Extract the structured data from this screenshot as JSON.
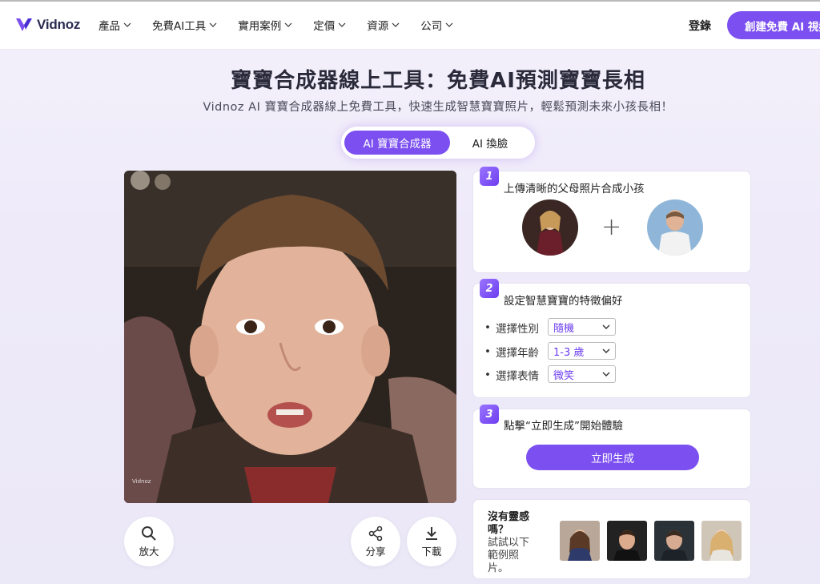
{
  "nav": {
    "logo_text": "Vidnoz",
    "menu": [
      {
        "label": "產品"
      },
      {
        "label": "免費AI工具"
      },
      {
        "label": "實用案例"
      },
      {
        "label": "定價"
      },
      {
        "label": "資源"
      },
      {
        "label": "公司"
      }
    ],
    "login_label": "登錄",
    "cta_label": "創建免費 AI 視頻"
  },
  "header": {
    "title": "寶寶合成器線上工具：免費AI預測寶寶長相",
    "subtitle": "Vidnoz AI 寶寶合成器線上免費工具，快速生成智慧寶寶照片，輕鬆預測未來小孩長相！"
  },
  "tabs": [
    {
      "label": "AI 寶寶合成器",
      "active": true
    },
    {
      "label": "AI 換臉",
      "active": false
    }
  ],
  "result": {
    "watermark": "Vidnoz",
    "zoom_label": "放大",
    "share_label": "分享",
    "download_label": "下載"
  },
  "steps": {
    "step1": {
      "num": "1",
      "title": "上傳清晰的父母照片合成小孩",
      "plus": "+"
    },
    "step2": {
      "num": "2",
      "title": "設定智慧寶寶的特徵偏好",
      "rows": [
        {
          "label": "選擇性別",
          "value": "隨機"
        },
        {
          "label": "選擇年齡",
          "value": "1-3 歲"
        },
        {
          "label": "選擇表情",
          "value": "微笑"
        }
      ]
    },
    "step3": {
      "num": "3",
      "title": "點擊“立即生成”開始體驗",
      "button": "立即生成"
    }
  },
  "examples": {
    "line1": "沒有靈感嗎？",
    "line2": "試試以下範例照片。"
  },
  "colors": {
    "accent": "#7b4ff0",
    "accent_light": "#9b74ff"
  }
}
